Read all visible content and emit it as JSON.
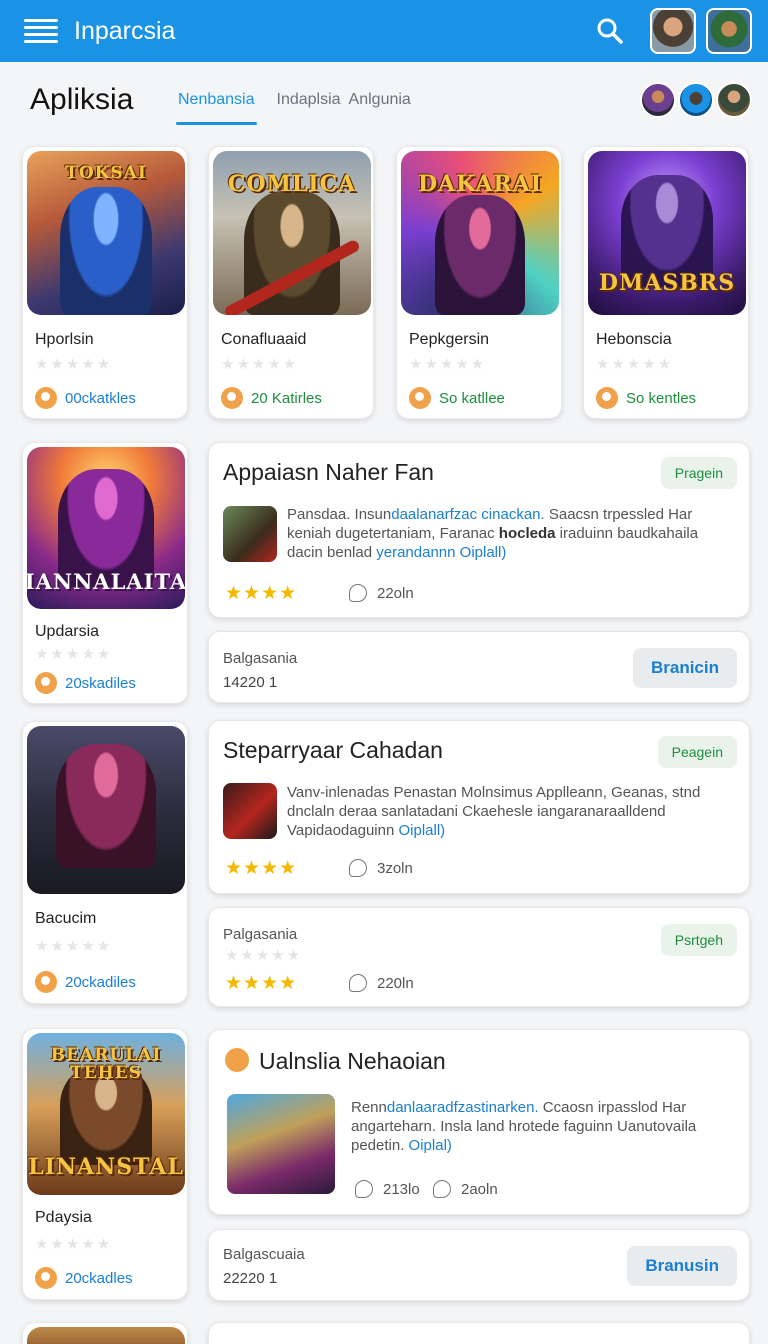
{
  "topbar": {
    "title": "Inparcsia"
  },
  "header": {
    "page_title": "Apliksia",
    "tabs": [
      {
        "label": "Nenbansia",
        "active": true
      },
      {
        "label": "Indaplsia"
      },
      {
        "label": "Anlgunia"
      }
    ]
  },
  "apps": [
    {
      "name": "Hporlsin",
      "thumb_title": "TOKSAI",
      "downloads": "00ckatkles",
      "downloads_color": "blue"
    },
    {
      "name": "Conafluaaid",
      "thumb_title": "COMLICA",
      "downloads": "20 Katirles",
      "downloads_color": "green"
    },
    {
      "name": "Pepkgersin",
      "thumb_title": "DAKARAI",
      "downloads": "So katllee",
      "downloads_color": "green"
    },
    {
      "name": "Hebonscia",
      "thumb_title": "DMASBRS",
      "downloads": "So kentles",
      "downloads_color": "green"
    },
    {
      "name": "Updarsia",
      "thumb_title": "IANNALAITA",
      "downloads": "20skadiles",
      "downloads_color": "blue"
    },
    {
      "name": "Bacucim",
      "thumb_title": "",
      "downloads": "20ckadiles",
      "downloads_color": "blue"
    },
    {
      "name": "Pdaysia",
      "thumb_title": "BEARULAI TEHES",
      "thumb_title_bottom": "LINANSTAL",
      "downloads": "20ckadles",
      "downloads_color": "blue"
    }
  ],
  "details": [
    {
      "title": "Appaiasn Naher Fan",
      "pill": "Pragein",
      "desc_a": "Pansdaa. Insun",
      "desc_hl1": "daalanarfzac cinackan.",
      "desc_b": " Saacsn trpessled Har keniah dugetertaniam, Faranac ",
      "desc_bold": "hocleda",
      "desc_c": " iraduinn baudkahaila dacin benlad ",
      "desc_hl2": "yerandannn Oiplall)",
      "rating_count": "22oln"
    },
    {
      "title": "Steparryaar Cahadan",
      "pill": "Peagein",
      "desc_a": "Vanv-inlenadas Penastan Molnsimus Applleann, Geanas, stnd dnclaln deraa sanlatadani Ckaehesle iangaranaraalldend Vapidaodaguinn ",
      "desc_hl2": "Oiplall)",
      "rating_count": "3zoln"
    },
    {
      "title": "Ualnslia Nehaoian",
      "desc_a": "Renn",
      "desc_hl1": "danlaaradfzastinarken.",
      "desc_b": " Ccaosn irpasslod Har angarteharn. Insla land hrotede faguinn Uanutovaila pedetin. ",
      "desc_hl2": "Oiplal)",
      "comments": "213lo",
      "rating_count": "2aoln"
    }
  ],
  "subs": [
    {
      "label": "Balgasania",
      "number": "14220 1",
      "button": "Branicin"
    },
    {
      "label": "Palgasania",
      "pill": "Psrtgeh",
      "rating_count": "220ln"
    },
    {
      "label": "Balgascuaia",
      "number": "22220 1",
      "button": "Branusin"
    }
  ],
  "icons": {
    "menu": "hamburger-icon",
    "search": "search-icon",
    "download": "download-icon",
    "comment": "comment-icon"
  },
  "colors": {
    "brand": "#1a93e6",
    "green": "#1e8e3e",
    "star": "#f5b800"
  }
}
